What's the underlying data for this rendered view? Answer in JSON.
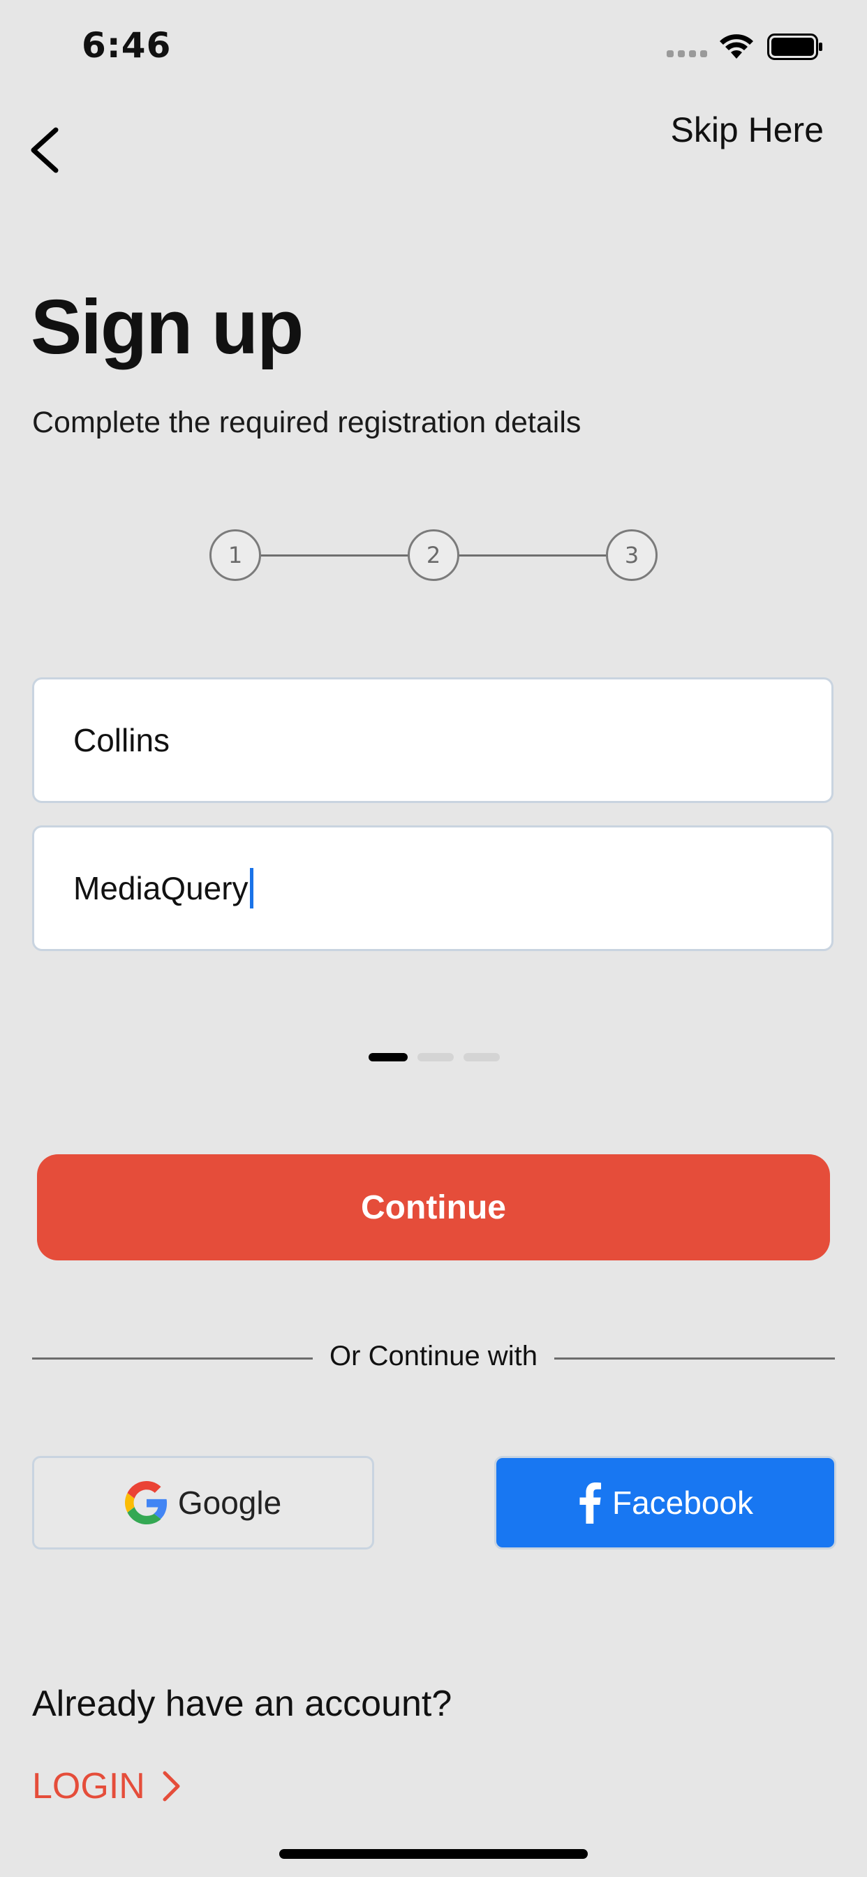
{
  "status_bar": {
    "time": "6:46",
    "icons": [
      "signal-icon",
      "wifi-icon",
      "battery-icon"
    ]
  },
  "header": {
    "back_icon": "chevron-left-icon",
    "skip_label": "Skip Here"
  },
  "title": "Sign up",
  "subtitle": "Complete the required registration details",
  "stepper": {
    "steps": [
      "1",
      "2",
      "3"
    ]
  },
  "form": {
    "first_name_value": "Collins",
    "last_name_value": "MediaQuery"
  },
  "pager": {
    "count": 3,
    "active_index": 0
  },
  "continue_label": "Continue",
  "divider_label": "Or Continue with",
  "social": {
    "google_label": "Google",
    "facebook_label": "Facebook"
  },
  "footer": {
    "account_prompt": "Already have an account?",
    "login_label": "LOGIN",
    "login_icon": "chevron-right-icon"
  },
  "colors": {
    "background": "#e6e6e6",
    "accent": "#e54d3a",
    "facebook": "#1877f2",
    "caret": "#1a73e8"
  }
}
